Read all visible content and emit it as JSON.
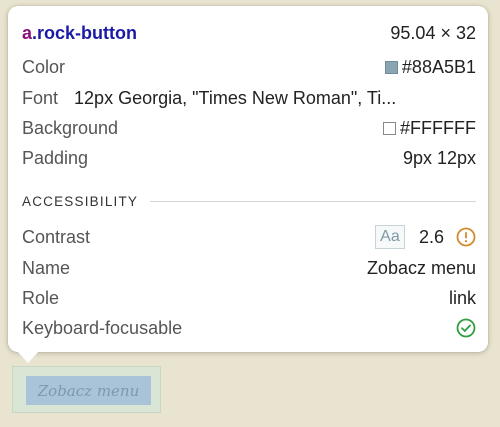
{
  "header": {
    "tag": "a",
    "class_name": ".rock-button",
    "dimensions": "95.04 × 32"
  },
  "properties": {
    "color_label": "Color",
    "color_value": "#88A5B1",
    "font_label": "Font",
    "font_value": "12px Georgia, \"Times New Roman\", Ti...",
    "background_label": "Background",
    "background_value": "#FFFFFF",
    "padding_label": "Padding",
    "padding_value": "9px 12px"
  },
  "accessibility": {
    "section_title": "ACCESSIBILITY",
    "contrast_label": "Contrast",
    "contrast_badge": "Aa",
    "contrast_value": "2.6",
    "name_label": "Name",
    "name_value": "Zobacz menu",
    "role_label": "Role",
    "role_value": "link",
    "keyboard_label": "Keyboard-focusable"
  },
  "element": {
    "text": "Zobacz menu"
  },
  "colors": {
    "swatch_color": "#88A5B1",
    "swatch_background": "#FFFFFF",
    "warning": "#d08a2a",
    "success": "#2e9e3e"
  },
  "icons": {
    "contrast_warning": "warning-circle-icon",
    "keyboard_focusable": "check-circle-icon"
  }
}
